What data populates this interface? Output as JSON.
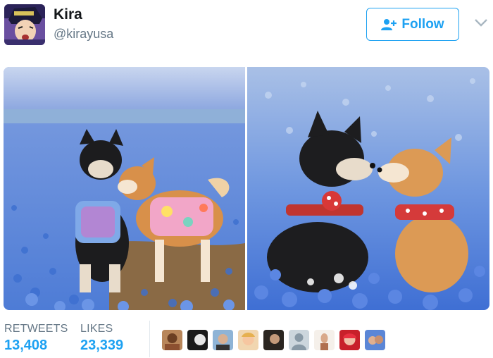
{
  "user": {
    "display_name": "Kira",
    "handle": "@kirayusa",
    "avatar_icon": "anime-character-avatar"
  },
  "follow_button": {
    "label": "Follow",
    "icon": "add-user-icon",
    "color": "#1da1f2"
  },
  "menu": {
    "icon": "chevron-down-icon"
  },
  "media": {
    "photos": [
      {
        "icon": "photo-two-shiba-dogs-in-blue-flower-field"
      },
      {
        "icon": "photo-two-shiba-dogs-nose-to-nose"
      }
    ]
  },
  "stats": {
    "retweets": {
      "label": "RETWEETS",
      "value": "13,408"
    },
    "likes": {
      "label": "LIKES",
      "value": "23,339"
    }
  },
  "likers_count_shown": 9,
  "colors": {
    "accent": "#1da1f2",
    "secondary_text": "#657786",
    "divider": "#e1e8ed"
  }
}
